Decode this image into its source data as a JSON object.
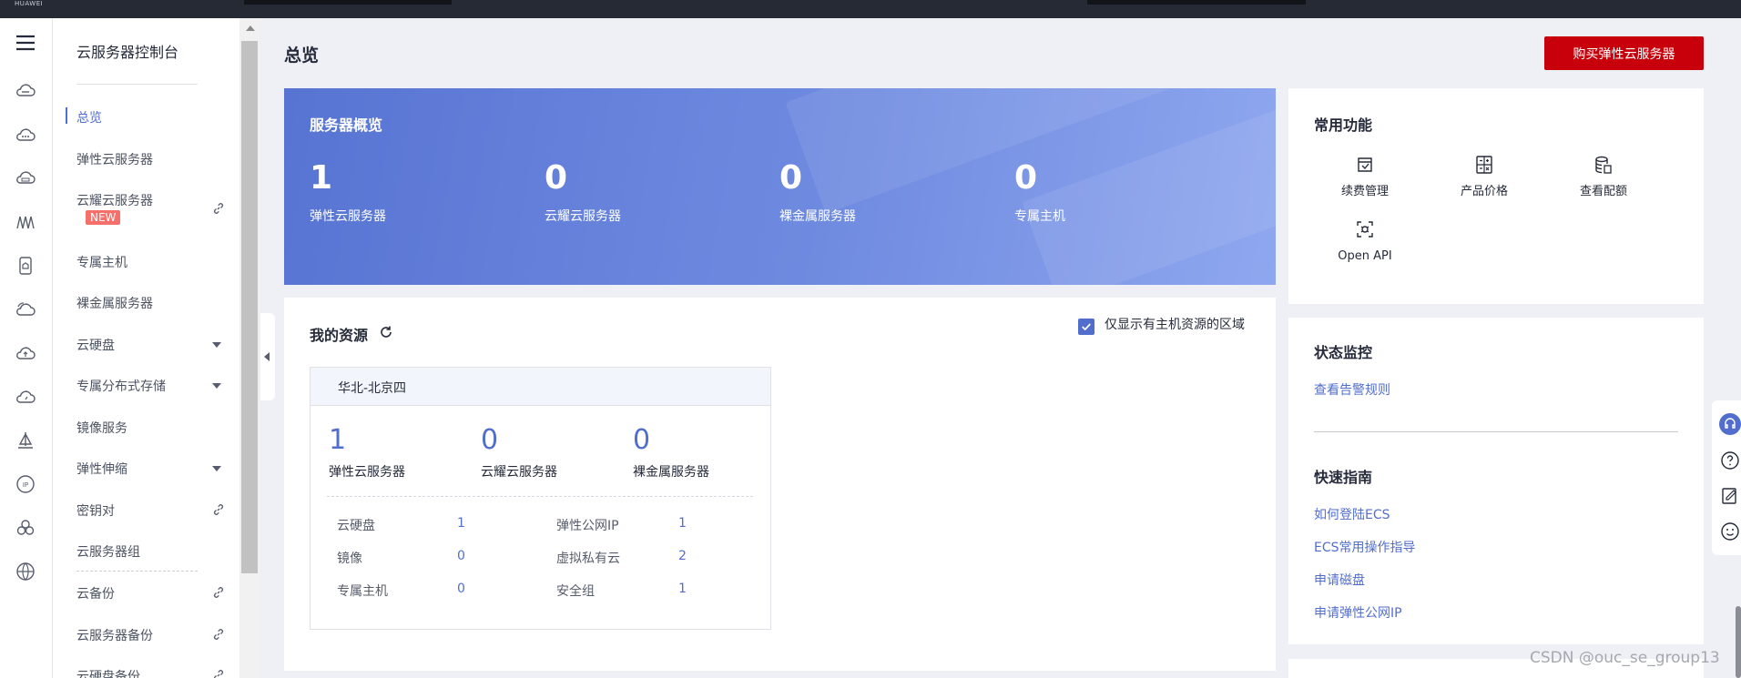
{
  "brand": "HUAWEI",
  "sidebar": {
    "title": "云服务器控制台",
    "items": [
      {
        "label": "总览",
        "active": true
      },
      {
        "label": "弹性云服务器"
      },
      {
        "label": "云耀云服务器",
        "badge": "NEW",
        "link": true
      },
      {
        "label": "专属主机"
      },
      {
        "label": "裸金属服务器"
      },
      {
        "label": "云硬盘",
        "expandable": true
      },
      {
        "label": "专属分布式存储",
        "expandable": true
      },
      {
        "label": "镜像服务"
      },
      {
        "label": "弹性伸缩",
        "expandable": true
      },
      {
        "label": "密钥对",
        "link": true
      },
      {
        "label": "云服务器组"
      },
      {
        "label": "云备份",
        "link": true
      },
      {
        "label": "云服务器备份",
        "link": true
      },
      {
        "label": "云硬盘备份",
        "link": true
      }
    ]
  },
  "header": {
    "title": "总览",
    "buy_button": "购买弹性云服务器"
  },
  "overview": {
    "title": "服务器概览",
    "stats": [
      {
        "value": "1",
        "label": "弹性云服务器"
      },
      {
        "value": "0",
        "label": "云耀云服务器"
      },
      {
        "value": "0",
        "label": "裸金属服务器"
      },
      {
        "value": "0",
        "label": "专属主机"
      }
    ]
  },
  "resources": {
    "title": "我的资源",
    "filter_checked": true,
    "filter_label": "仅显示有主机资源的区域",
    "region": {
      "name": "华北-北京四",
      "stats": [
        {
          "value": "1",
          "label": "弹性云服务器"
        },
        {
          "value": "0",
          "label": "云耀云服务器"
        },
        {
          "value": "0",
          "label": "裸金属服务器"
        }
      ],
      "details": [
        {
          "key": "云硬盘",
          "value": "1",
          "key2": "弹性公网IP",
          "value2": "1"
        },
        {
          "key": "镜像",
          "value": "0",
          "key2": "虚拟私有云",
          "value2": "2"
        },
        {
          "key": "专属主机",
          "value": "0",
          "key2": "安全组",
          "value2": "1"
        }
      ]
    }
  },
  "common_functions": {
    "title": "常用功能",
    "items": [
      {
        "label": "续费管理",
        "icon": "renew-icon"
      },
      {
        "label": "产品价格",
        "icon": "calculator-icon"
      },
      {
        "label": "查看配额",
        "icon": "quota-icon"
      },
      {
        "label": "Open API",
        "icon": "api-icon"
      }
    ]
  },
  "monitoring": {
    "title": "状态监控",
    "link": "查看告警规则"
  },
  "quick_guide": {
    "title": "快速指南",
    "links": [
      "如何登陆ECS",
      "ECS常用操作指导",
      "申请磁盘",
      "申请弹性公网IP"
    ]
  },
  "watermark": "CSDN @ouc_se_group13",
  "colors": {
    "accent": "#526ecc",
    "buy_button": "#c7000b",
    "topbar": "#252a35"
  }
}
